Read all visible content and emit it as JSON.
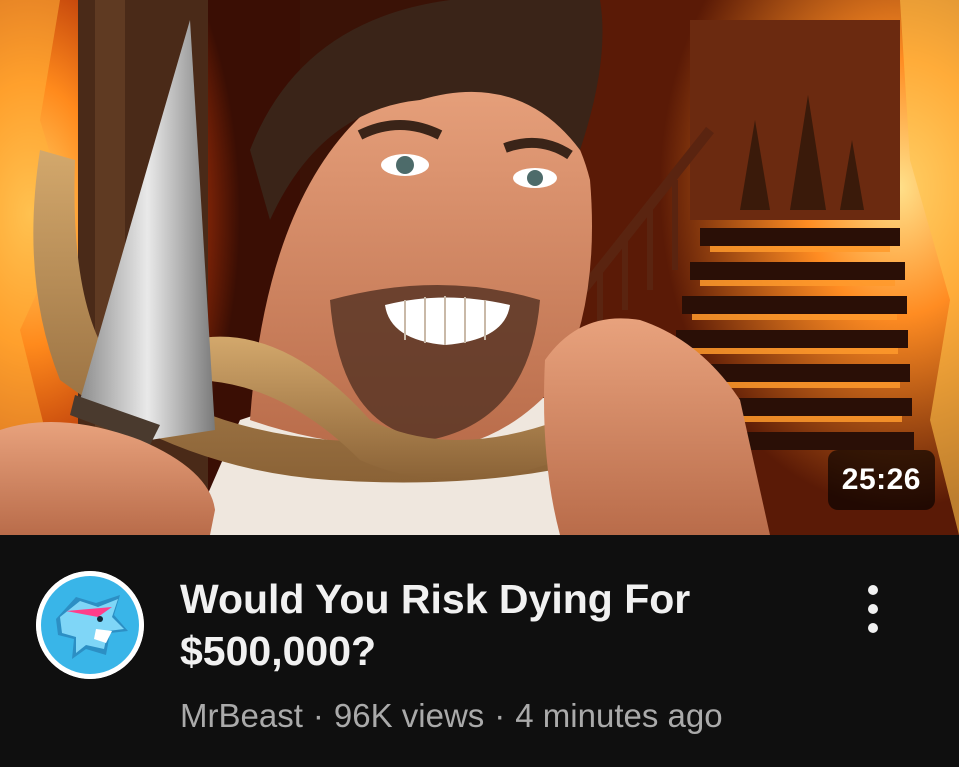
{
  "video": {
    "duration": "25:26",
    "title": "Would You Risk Dying For $500,000?",
    "channel": "MrBeast",
    "views": "96K views",
    "age": "4 minutes ago",
    "separator": "·"
  },
  "icons": {
    "more": "vertical-ellipsis-icon",
    "avatar": "mrbeast-panther-logo"
  },
  "colors": {
    "background": "#0f0f0f",
    "title": "#f1f1f1",
    "meta": "#aaaaaa",
    "fire": "#ff7a1a",
    "avatar_blue": "#39b5e8",
    "avatar_pink": "#ff3e8a"
  }
}
